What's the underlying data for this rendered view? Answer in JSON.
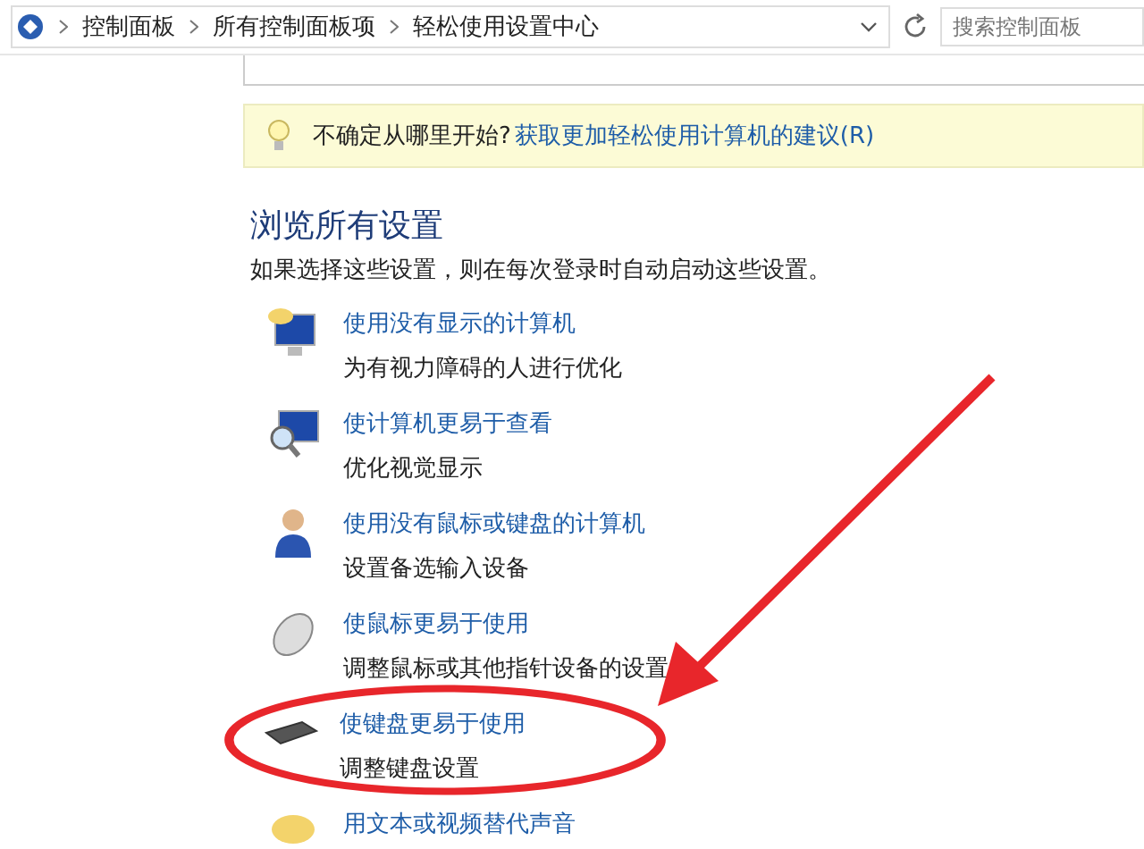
{
  "address_bar": {
    "breadcrumbs": [
      "控制面板",
      "所有控制面板项",
      "轻松使用设置中心"
    ],
    "search": {
      "placeholder": "搜索控制面板"
    }
  },
  "tip": {
    "text": "不确定从哪里开始?",
    "link": "获取更加轻松使用计算机的建议(R)"
  },
  "section": {
    "title": "浏览所有设置",
    "description": "如果选择这些设置，则在每次登录时自动启动这些设置。"
  },
  "items": [
    {
      "kind": "narrator",
      "title": "使用没有显示的计算机",
      "subtitle": "为有视力障碍的人进行优化",
      "highlighted": false
    },
    {
      "kind": "magnifier",
      "title": "使计算机更易于查看",
      "subtitle": "优化视觉显示",
      "highlighted": false
    },
    {
      "kind": "person",
      "title": "使用没有鼠标或键盘的计算机",
      "subtitle": "设置备选输入设备",
      "highlighted": false
    },
    {
      "kind": "mouse",
      "title": "使鼠标更易于使用",
      "subtitle": "调整鼠标或其他指针设备的设置",
      "highlighted": false
    },
    {
      "kind": "keyboard",
      "title": "使键盘更易于使用",
      "subtitle": "调整键盘设置",
      "highlighted": true
    },
    {
      "kind": "speech",
      "title": "用文本或视频替代声音",
      "highlighted": false
    }
  ]
}
